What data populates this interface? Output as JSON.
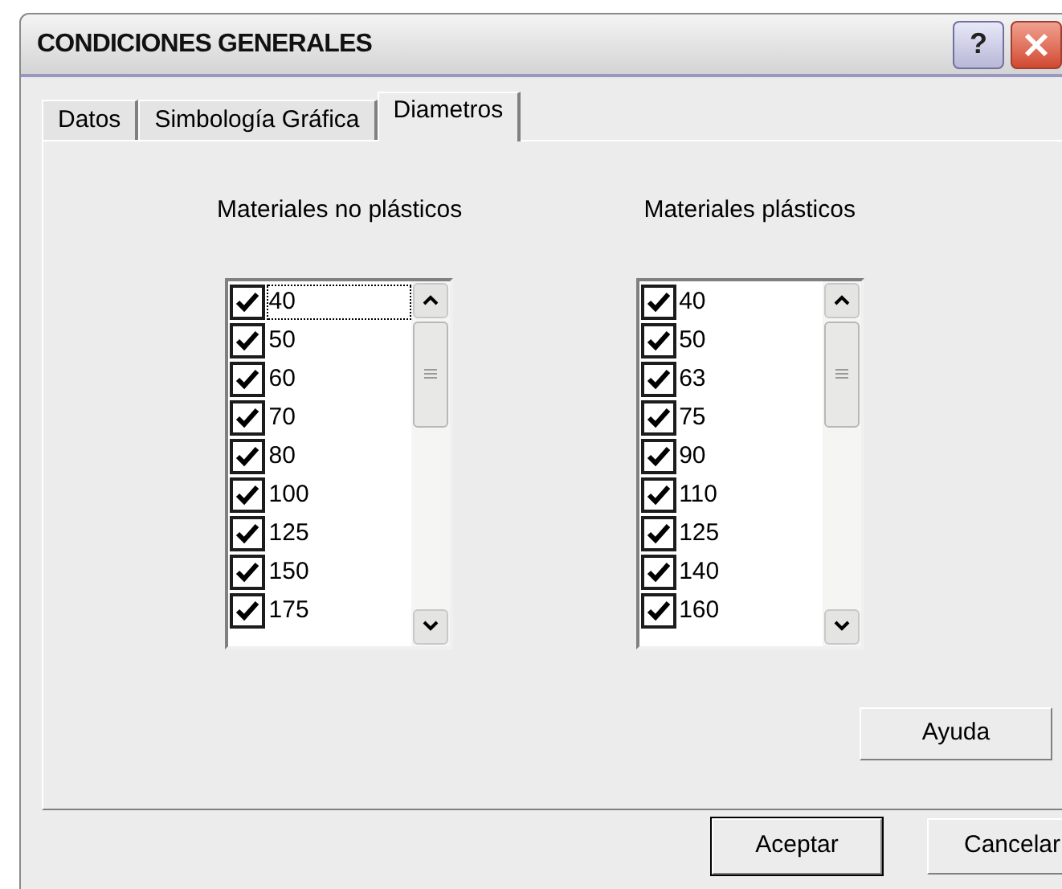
{
  "window": {
    "title": "CONDICIONES GENERALES",
    "help_glyph": "?"
  },
  "tabs": [
    {
      "label": "Datos",
      "selected": false
    },
    {
      "label": "Simbología Gráfica",
      "selected": false
    },
    {
      "label": "Diametros",
      "selected": true
    }
  ],
  "lists": [
    {
      "title": "Materiales no plásticos",
      "items": [
        {
          "label": "40",
          "checked": true,
          "focused": true
        },
        {
          "label": "50",
          "checked": true,
          "focused": false
        },
        {
          "label": "60",
          "checked": true,
          "focused": false
        },
        {
          "label": "70",
          "checked": true,
          "focused": false
        },
        {
          "label": "80",
          "checked": true,
          "focused": false
        },
        {
          "label": "100",
          "checked": true,
          "focused": false
        },
        {
          "label": "125",
          "checked": true,
          "focused": false
        },
        {
          "label": "150",
          "checked": true,
          "focused": false
        },
        {
          "label": "175",
          "checked": true,
          "focused": false
        }
      ]
    },
    {
      "title": "Materiales plásticos",
      "items": [
        {
          "label": "40",
          "checked": true,
          "focused": false
        },
        {
          "label": "50",
          "checked": true,
          "focused": false
        },
        {
          "label": "63",
          "checked": true,
          "focused": false
        },
        {
          "label": "75",
          "checked": true,
          "focused": false
        },
        {
          "label": "90",
          "checked": true,
          "focused": false
        },
        {
          "label": "110",
          "checked": true,
          "focused": false
        },
        {
          "label": "125",
          "checked": true,
          "focused": false
        },
        {
          "label": "140",
          "checked": true,
          "focused": false
        },
        {
          "label": "160",
          "checked": true,
          "focused": false
        }
      ]
    }
  ],
  "help_button": "Ayuda",
  "buttons": [
    {
      "label": "Aceptar",
      "default": true
    },
    {
      "label": "Cancelar",
      "default": false
    }
  ]
}
